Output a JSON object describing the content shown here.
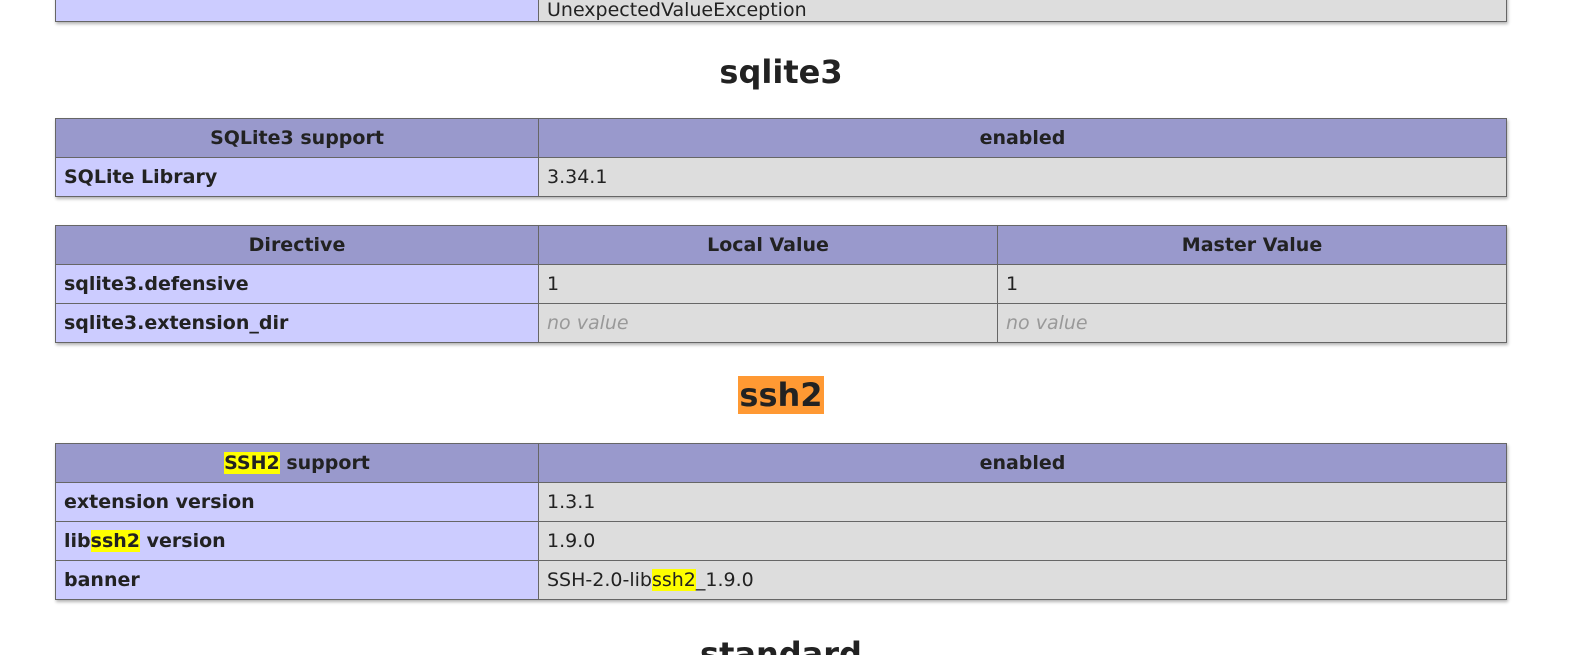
{
  "top_strip": {
    "value": "UnexpectedValueException"
  },
  "sqlite3": {
    "title": "sqlite3",
    "info_table": {
      "header": [
        "SQLite3 support",
        "enabled"
      ],
      "rows": [
        {
          "name": "SQLite Library",
          "value": "3.34.1"
        }
      ]
    },
    "directive_table": {
      "header": [
        "Directive",
        "Local Value",
        "Master Value"
      ],
      "rows": [
        {
          "name": "sqlite3.defensive",
          "local": "1",
          "master": "1"
        },
        {
          "name": "sqlite3.extension_dir",
          "local": "no value",
          "master": "no value"
        }
      ]
    }
  },
  "ssh2": {
    "title": "ssh2",
    "info_table": {
      "header_left_highlight": "SSH2",
      "header_left_rest": " support",
      "header_right": "enabled",
      "rows": {
        "ext_version_name": "extension version",
        "ext_version_value": "1.3.1",
        "lib_name_prefix": "lib",
        "lib_name_highlight": "ssh2",
        "lib_name_suffix": " version",
        "lib_value": "1.9.0",
        "banner_name": "banner",
        "banner_value_prefix": "SSH-2.0-lib",
        "banner_value_highlight": "ssh2",
        "banner_value_suffix": "_1.9.0"
      }
    }
  },
  "next_section": {
    "title": "standard"
  },
  "colors": {
    "header_bg": "#9999cc",
    "name_bg": "#ccccff",
    "value_bg": "#dddddd",
    "search_highlight": "#ffff00",
    "current_match_highlight": "#ff9933"
  }
}
